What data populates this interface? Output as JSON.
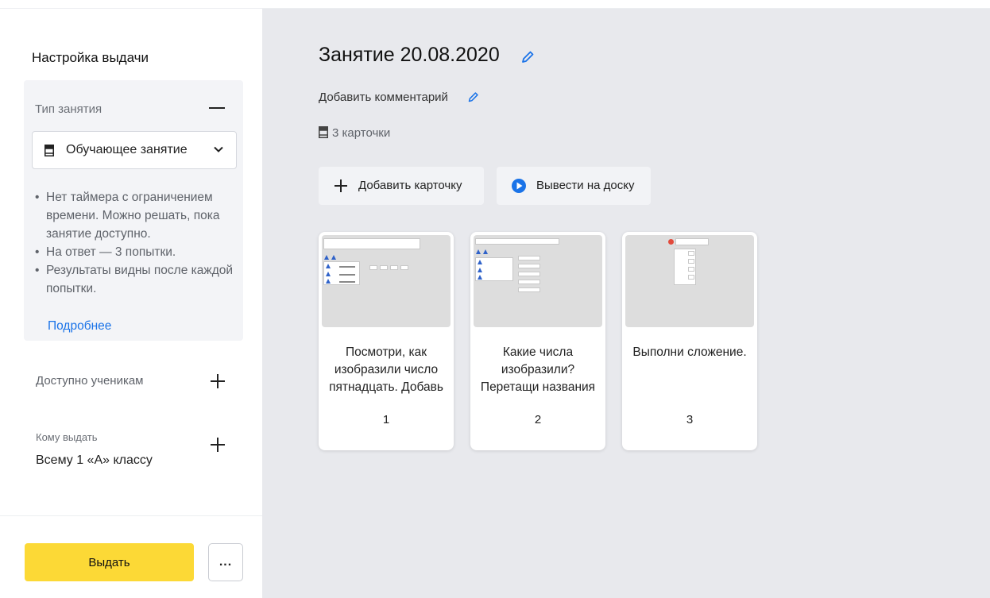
{
  "sidebar": {
    "title": "Настройка выдачи",
    "lesson_type": {
      "label": "Тип занятия",
      "selected": "Обучающее занятие",
      "rules": [
        "Нет таймера с ограничением времени. Можно решать, пока занятие доступно.",
        "На ответ — 3 попытки.",
        "Результаты видны после каждой попытки."
      ],
      "more_link": "Подробнее"
    },
    "available_label": "Доступно ученикам",
    "whom": {
      "label": "Кому выдать",
      "value": "Всему 1 «А» классу"
    },
    "issue_button": "Выдать",
    "more_button": "..."
  },
  "main": {
    "title": "Занятие 20.08.2020",
    "add_comment": "Добавить комментарий",
    "cards_count": "3 карточки",
    "add_card_button": "Добавить карточку",
    "board_button": "Вывести на доску",
    "cards": [
      {
        "text": "Посмотри, как изобразили число пятнадцать. Добавь",
        "number": "1"
      },
      {
        "text": "Какие числа изобразили? Перетащи названия",
        "number": "2"
      },
      {
        "text": "Выполни сложение.",
        "number": "3"
      }
    ]
  },
  "colors": {
    "accent_yellow": "#fcd936",
    "link_blue": "#1a73e8",
    "main_bg": "#e8e9ed"
  },
  "icons": [
    "minus-icon",
    "book-icon",
    "chevron-down-icon",
    "plus-icon",
    "pencil-icon",
    "play-icon",
    "ellipsis-icon"
  ]
}
